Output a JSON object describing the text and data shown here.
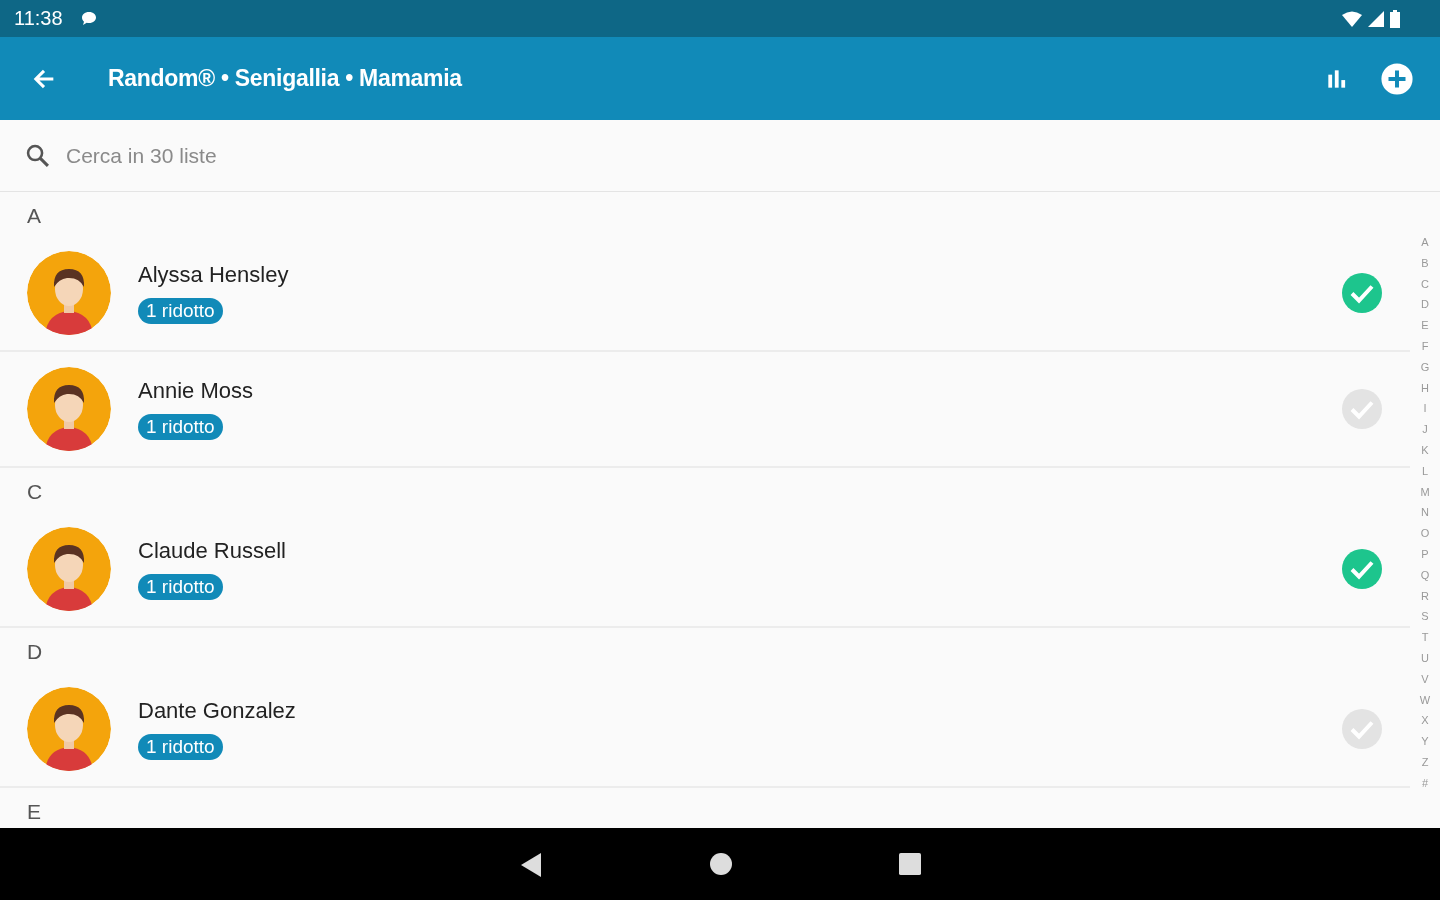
{
  "status_bar": {
    "time": "11:38"
  },
  "app_bar": {
    "title": "Random® • Senigallia • Mamamia"
  },
  "search": {
    "placeholder": "Cerca in 30 liste"
  },
  "sections": [
    {
      "letter": "A",
      "contacts": [
        {
          "name": "Alyssa Hensley",
          "badge": "1 ridotto",
          "checked": true
        },
        {
          "name": "Annie Moss",
          "badge": "1 ridotto",
          "checked": false
        }
      ]
    },
    {
      "letter": "C",
      "contacts": [
        {
          "name": "Claude Russell",
          "badge": "1 ridotto",
          "checked": true
        }
      ]
    },
    {
      "letter": "D",
      "contacts": [
        {
          "name": "Dante Gonzalez",
          "badge": "1 ridotto",
          "checked": false
        }
      ]
    },
    {
      "letter": "E"
    }
  ],
  "alphabet_index": [
    "A",
    "B",
    "C",
    "D",
    "E",
    "F",
    "G",
    "H",
    "I",
    "J",
    "K",
    "L",
    "M",
    "N",
    "O",
    "P",
    "Q",
    "R",
    "S",
    "T",
    "U",
    "V",
    "W",
    "X",
    "Y",
    "Z",
    "#"
  ]
}
